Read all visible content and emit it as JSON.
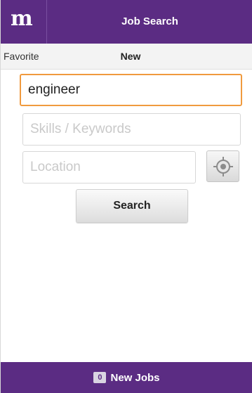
{
  "header": {
    "logo": "m",
    "title": "Job Search"
  },
  "tabs": {
    "favorite": "Favorite",
    "new": "New"
  },
  "form": {
    "job_title_value": "engineer",
    "skills_placeholder": "Skills / Keywords",
    "location_placeholder": "Location",
    "locate_icon": "crosshair-icon",
    "search_label": "Search"
  },
  "footer": {
    "count": "0",
    "label": "New Jobs"
  },
  "colors": {
    "brand": "#5b2c83",
    "focus": "#f09a3e"
  }
}
